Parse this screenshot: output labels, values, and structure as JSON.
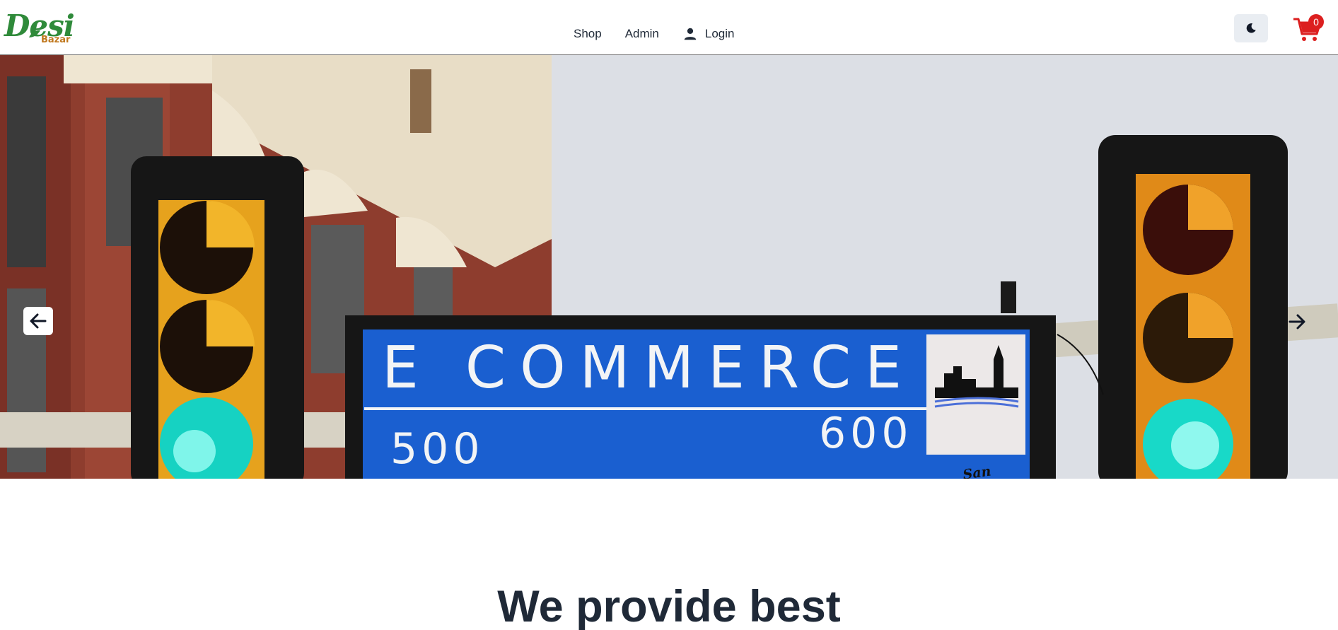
{
  "brand": {
    "logo_word": "Desi",
    "logo_sub": "Bazar"
  },
  "nav": {
    "links": [
      "Shop",
      "Admin"
    ],
    "login_label": "Login"
  },
  "header_actions": {
    "theme_icon": "moon-icon",
    "cart_icon": "shopping-cart-icon",
    "cart_count": "0",
    "cart_badge_color": "#dc1f1f"
  },
  "hero": {
    "sign_main": "E COMMERCE",
    "sign_left_number": "500",
    "sign_right_number": "600",
    "sign_city": "San Antonio",
    "prev_icon": "arrow-left-icon",
    "next_icon": "arrow-right-icon",
    "sign_color": "#1a5fd0"
  },
  "headline": "We provide best"
}
